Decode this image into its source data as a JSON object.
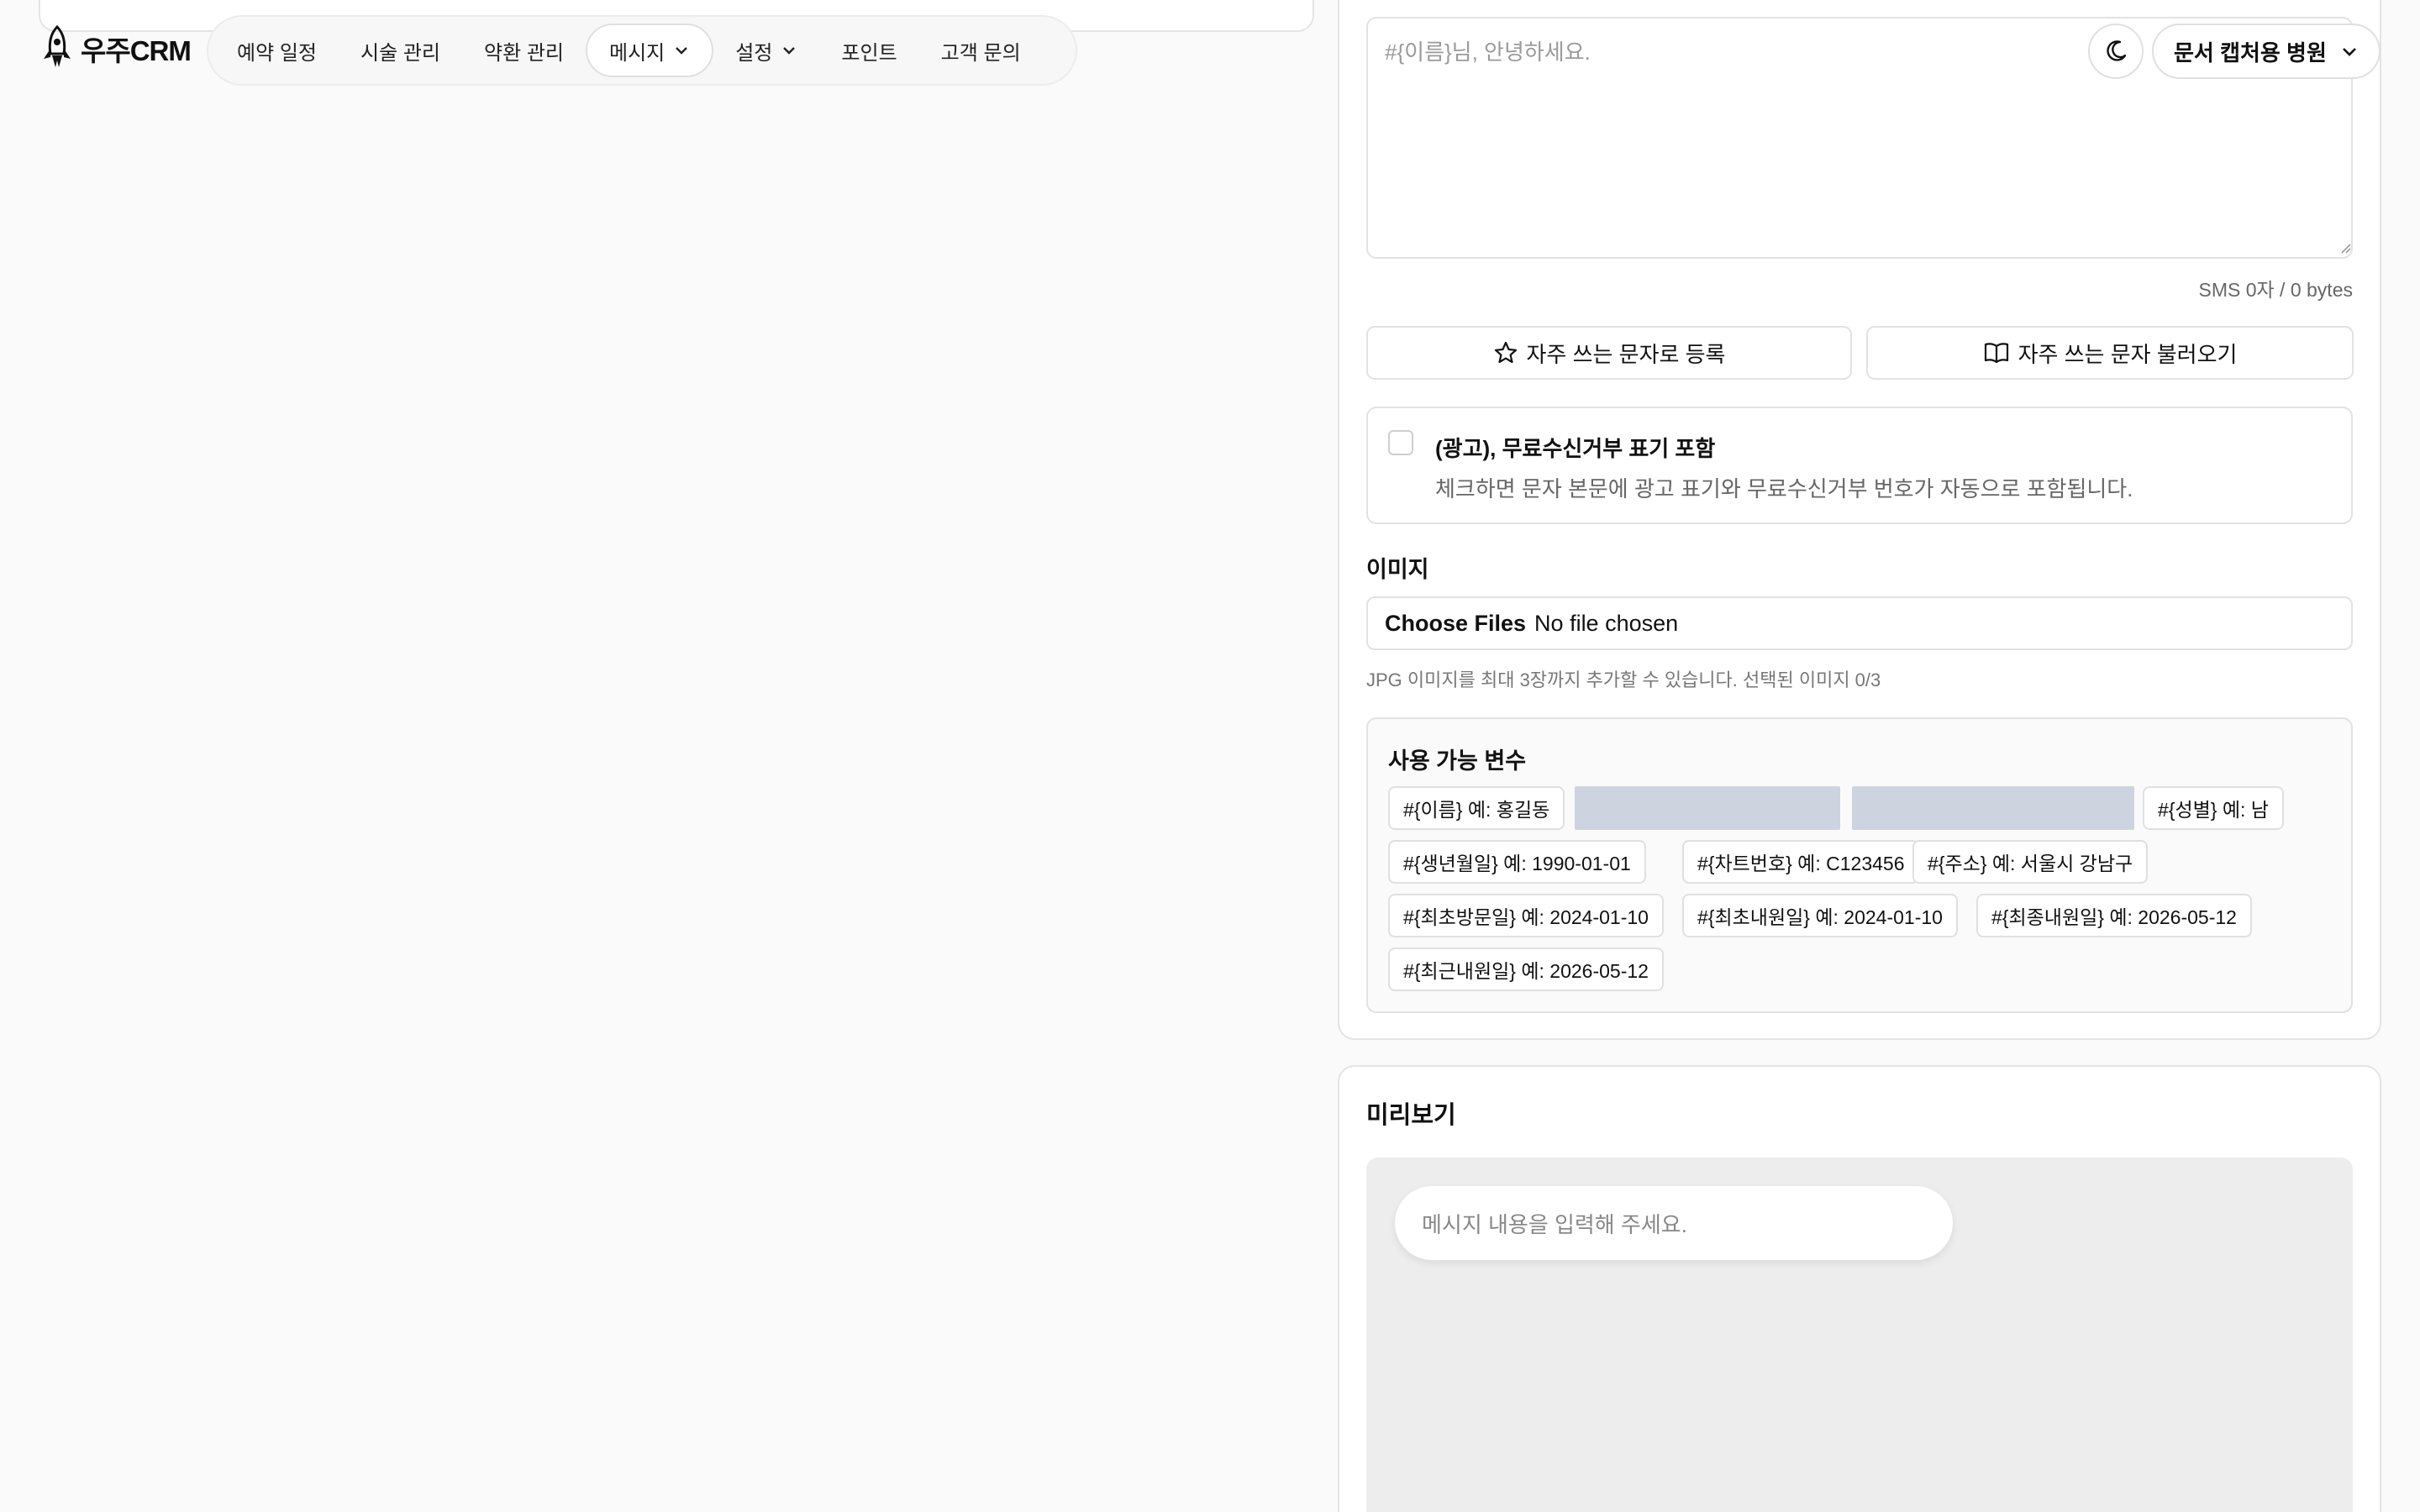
{
  "app": {
    "logo_text": "우주CRM"
  },
  "nav": {
    "items": [
      {
        "label": "예약 일정"
      },
      {
        "label": "시술 관리"
      },
      {
        "label": "약환 관리"
      },
      {
        "label": "메시지"
      },
      {
        "label": "설정"
      },
      {
        "label": "포인트"
      },
      {
        "label": "고객 문의"
      }
    ]
  },
  "header": {
    "clinic_select": "문서 캡처용 병원",
    "theme_icon": "moon-icon"
  },
  "composer": {
    "placeholder": "#{이름}님, 안녕하세요.",
    "value": "",
    "counter": "SMS 0자 / 0 bytes",
    "register_label": "자주 쓰는 문자로 등록",
    "load_label": "자주 쓰는 문자 불러오기"
  },
  "ad": {
    "title": "(광고), 무료수신거부 표기 포함",
    "description": "체크하면 문자 본문에 광고 표기와 무료수신거부 번호가 자동으로 포함됩니다.",
    "checked": false
  },
  "image": {
    "label": "이미지",
    "choose_button": "Choose Files",
    "status": "No file chosen",
    "hint": "JPG 이미지를 최대 3장까지 추가할 수 있습니다. 선택된 이미지 0/3"
  },
  "variables": {
    "title": "사용 가능 변수",
    "chips": [
      "#{이름} 예: 홍길동",
      "#{성별} 예: 남",
      "#{생년월일} 예: 1990-01-01",
      "#{차트번호} 예: C123456",
      "#{주소} 예: 서울시 강남구",
      "#{최초방문일} 예: 2024-01-10",
      "#{최초내원일} 예: 2024-01-10",
      "#{최종내원일} 예: 2026-05-12",
      "#{최근내원일} 예: 2026-05-12"
    ]
  },
  "preview": {
    "title": "미리보기",
    "bubble_text": "메시지 내용을 입력해 주세요."
  }
}
